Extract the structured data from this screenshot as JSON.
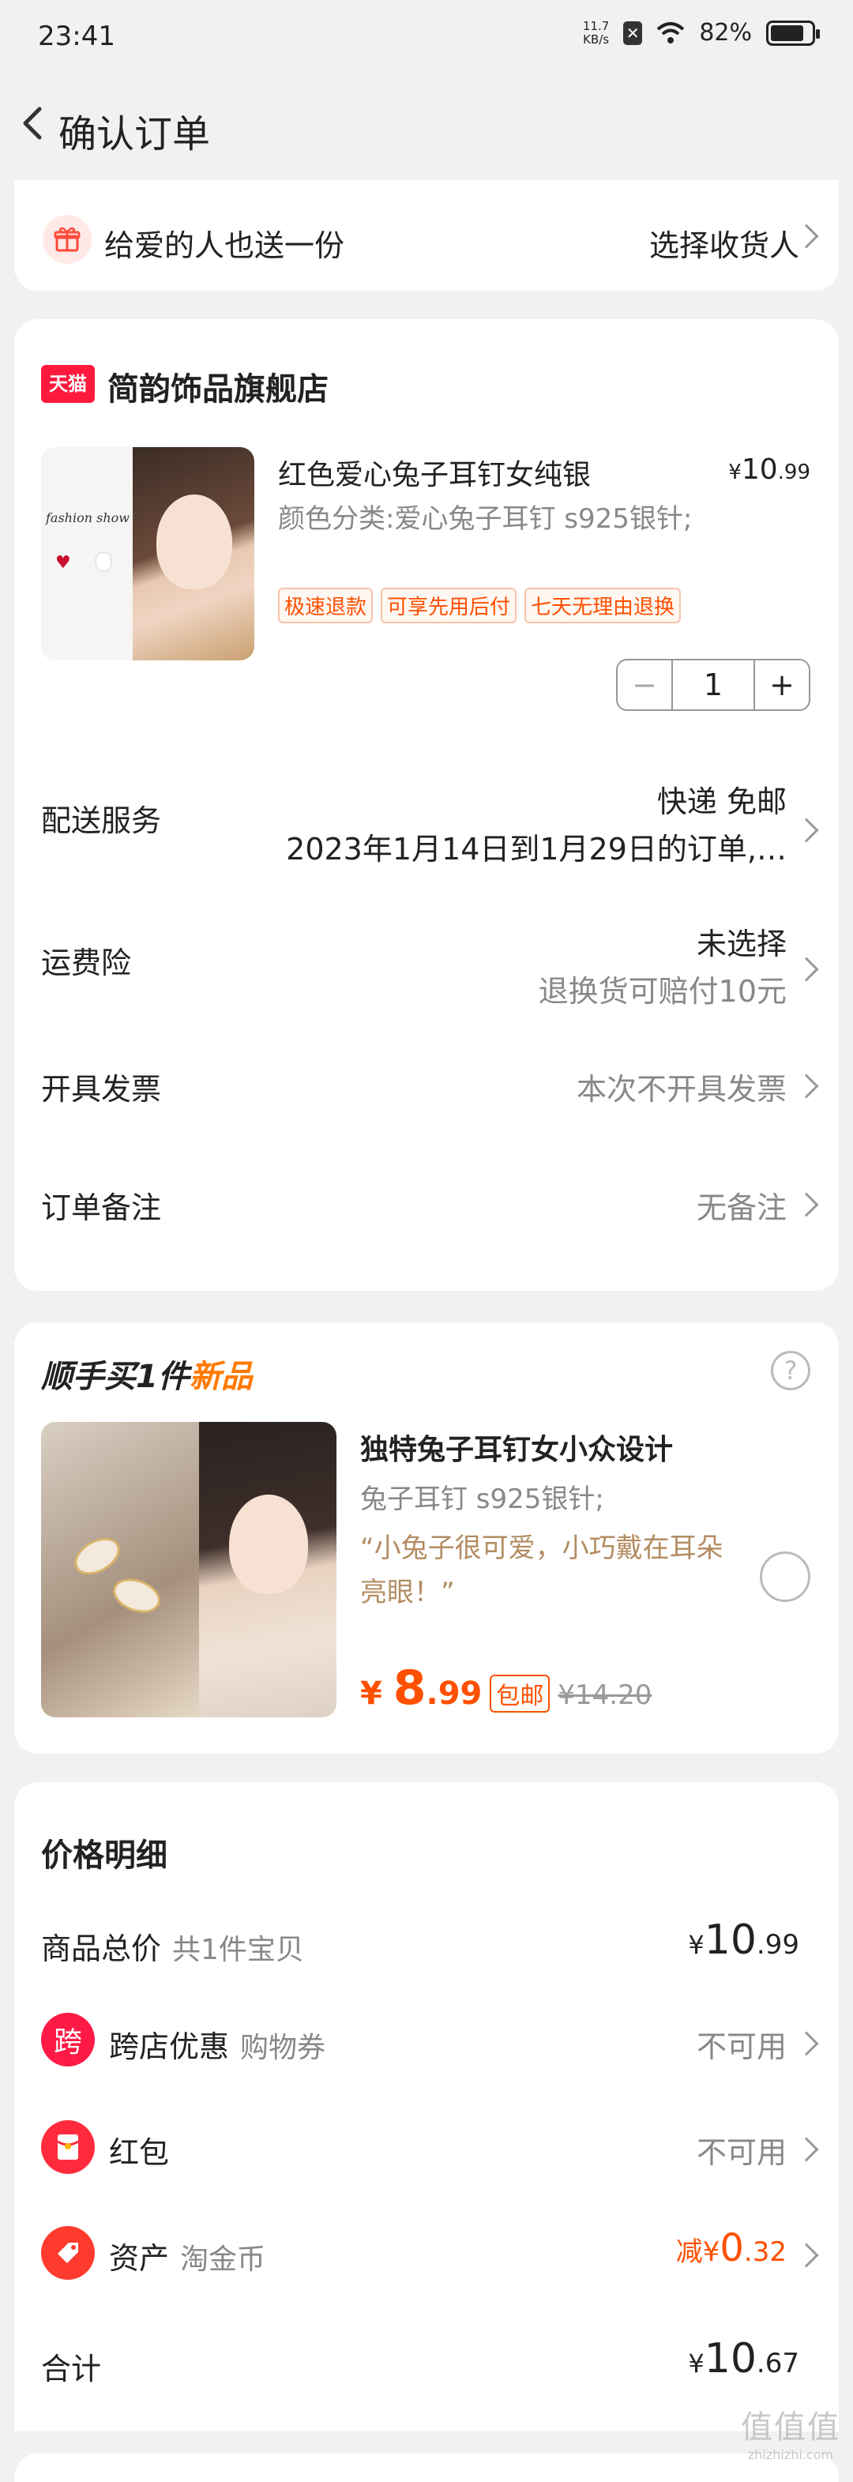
{
  "status": {
    "time": "23:41",
    "net_speed_top": "11.7",
    "net_speed_unit": "KB/s",
    "battery": "82%",
    "battery_fraction": 0.82
  },
  "nav": {
    "title": "确认订单"
  },
  "gift": {
    "text": "给爱的人也送一份",
    "action": "选择收货人"
  },
  "store": {
    "badge": "天猫",
    "name": "简韵饰品旗舰店",
    "product": {
      "title": "红色爱心兔子耳钉女纯银",
      "price_symbol": "¥",
      "price_int": "10",
      "price_dec": ".99",
      "spec": "颜色分类:爱心兔子耳钉 s925银针;",
      "image_text": "fashion show",
      "tags": [
        "极速退款",
        "可享先用后付",
        "七天无理由退换"
      ],
      "quantity": "1",
      "minus": "−",
      "plus": "+"
    },
    "delivery": {
      "label": "配送服务",
      "line1": "快递 免邮",
      "line2": "2023年1月14日到1月29日的订单,…"
    },
    "insurance": {
      "label": "运费险",
      "line1": "未选择",
      "line2": "退换货可赔付10元"
    },
    "invoice": {
      "label": "开具发票",
      "value": "本次不开具发票"
    },
    "remark": {
      "label": "订单备注",
      "value": "无备注"
    }
  },
  "addon": {
    "head": "顺手买1件",
    "head_tag": "新品",
    "help": "?",
    "title": "独特兔子耳钉女小众设计",
    "spec": "兔子耳钉 s925银针;",
    "quote": "“小兔子很可爱，小巧戴在耳朵亮眼！”",
    "price_symbol": "¥",
    "price_int": "8",
    "price_dec": ".99",
    "free_ship": "包邮",
    "orig_price": "¥14.20"
  },
  "detail": {
    "title": "价格明细",
    "goods_label": "商品总价",
    "goods_sub": "共1件宝贝",
    "goods_symbol": "¥",
    "goods_int": "10",
    "goods_dec": ".99",
    "cross_icon": "跨",
    "cross_label": "跨店优惠",
    "cross_sub": "购物券",
    "cross_value": "不可用",
    "red_label": "红包",
    "red_value": "不可用",
    "asset_label": "资产",
    "asset_sub": "淘金币",
    "asset_prefix": "减¥",
    "asset_int": "0",
    "asset_dec": ".32",
    "total_label": "合计",
    "total_symbol": "¥",
    "total_int": "10",
    "total_dec": ".67"
  },
  "watermark": {
    "big": "值值值",
    "small": "zhizhizhi.com"
  },
  "colors": {
    "accent": "#ff5000",
    "tmall": "#ff1a3d",
    "background": "#f1f1f1"
  }
}
